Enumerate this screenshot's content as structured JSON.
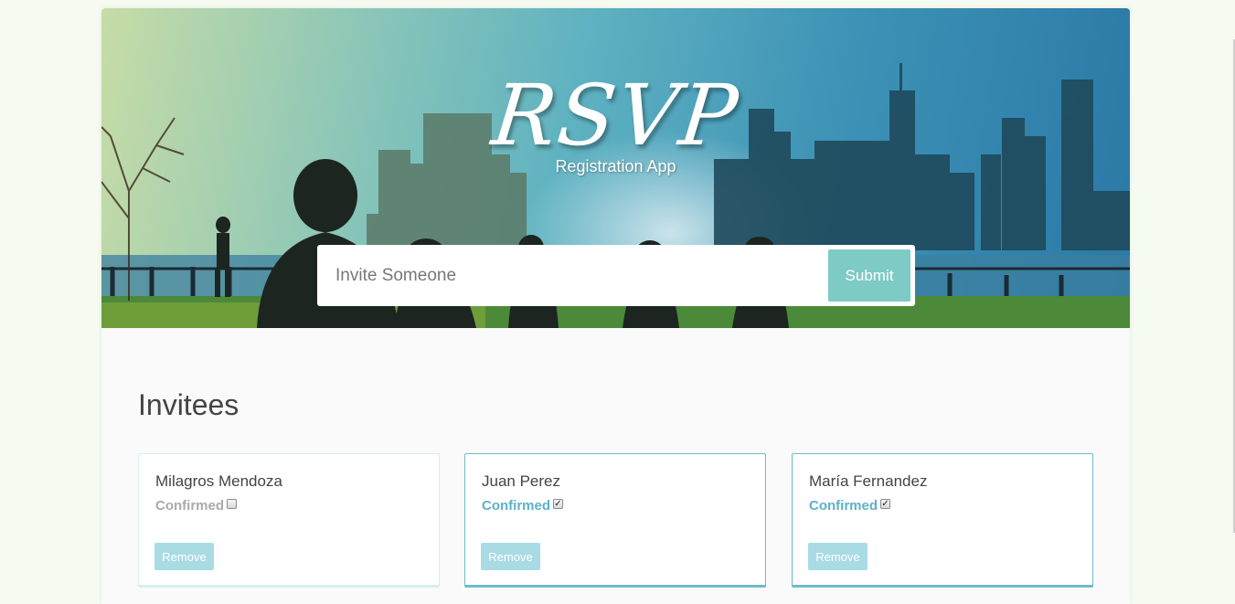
{
  "header": {
    "title": "RSVP",
    "subtitle": "Registration App"
  },
  "invite_form": {
    "placeholder": "Invite Someone",
    "value": "",
    "submit_label": "Submit"
  },
  "main": {
    "title": "Invitees",
    "invitees": [
      {
        "name": "Milagros Mendoza",
        "confirmed_label": "Confirmed",
        "confirmed": false,
        "remove_label": "Remove"
      },
      {
        "name": "Juan Perez",
        "confirmed_label": "Confirmed",
        "confirmed": true,
        "remove_label": "Remove"
      },
      {
        "name": "María Fernandez",
        "confirmed_label": "Confirmed",
        "confirmed": true,
        "remove_label": "Remove"
      }
    ]
  },
  "colors": {
    "accent": "#7ecac5",
    "confirmed_text": "#5cb2c8",
    "remove_button": "#a9dbe5",
    "page_background": "#f6fbf1"
  },
  "icons": {
    "checkbox_checked": "check-mark"
  }
}
